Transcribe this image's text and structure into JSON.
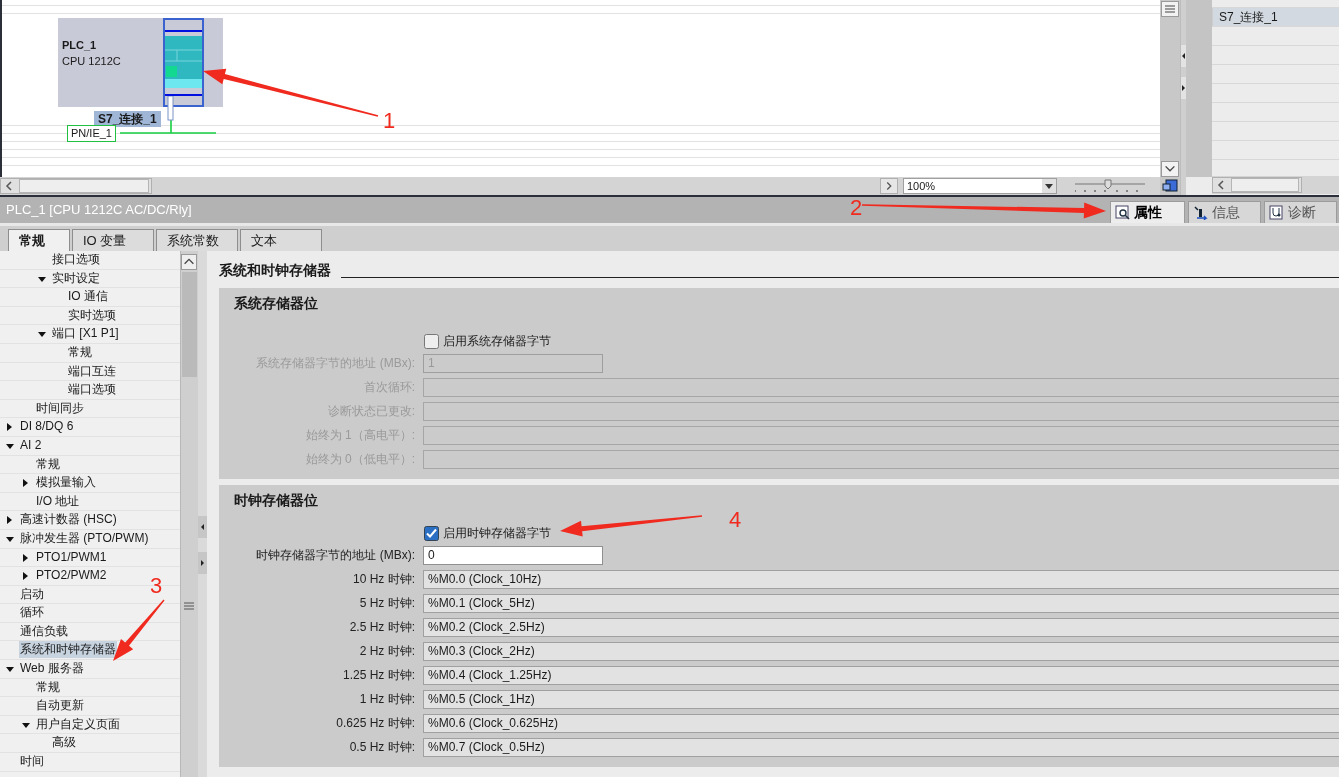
{
  "canvas": {
    "device": {
      "name": "PLC_1",
      "type": "CPU 1212C"
    },
    "connection_label": "S7_连接_1",
    "network_label": "PN/IE_1",
    "zoom": "100%",
    "zoom_slider": {
      "level": 0.47
    }
  },
  "connections_table": {
    "rows": [
      {
        "name": "S7_连接_1",
        "selected": true
      }
    ]
  },
  "inspector": {
    "title": "PLC_1 [CPU 1212C AC/DC/Rly]",
    "view_tabs": [
      {
        "label": "属性",
        "selected": true
      },
      {
        "label": "信息",
        "selected": false
      },
      {
        "label": "诊断",
        "selected": false
      }
    ],
    "tabs": [
      {
        "label": "常规",
        "selected": true
      },
      {
        "label": "IO 变量",
        "selected": false
      },
      {
        "label": "系统常数",
        "selected": false
      },
      {
        "label": "文本",
        "selected": false
      }
    ],
    "tree": [
      {
        "children": [
          {
            "children": [
              {
                "label": "接口选项",
                "selected": false
              },
              {
                "label": "实时设定",
                "selected": false,
                "expanded": true,
                "children": [
                  {
                    "label": "IO 通信",
                    "selected": false
                  },
                  {
                    "label": "实时选项",
                    "selected": false
                  }
                ]
              },
              {
                "label": "端口 [X1 P1]",
                "selected": false,
                "expanded": true,
                "children": [
                  {
                    "label": "常规",
                    "selected": false
                  },
                  {
                    "label": "端口互连",
                    "selected": false
                  },
                  {
                    "label": "端口选项",
                    "selected": false
                  }
                ]
              }
            ]
          },
          {
            "label": "时间同步",
            "selected": false
          }
        ]
      },
      {
        "label": "DI 8/DQ 6",
        "selected": false,
        "expanded": false
      },
      {
        "label": "AI 2",
        "selected": false,
        "expanded": true,
        "children": [
          {
            "label": "常规",
            "selected": false
          },
          {
            "label": "模拟量输入",
            "selected": false,
            "expanded": false
          },
          {
            "label": "I/O 地址",
            "selected": false
          }
        ]
      },
      {
        "label": "高速计数器 (HSC)",
        "selected": false,
        "expanded": false
      },
      {
        "label": "脉冲发生器 (PTO/PWM)",
        "selected": false,
        "expanded": true,
        "children": [
          {
            "label": "PTO1/PWM1",
            "selected": false,
            "expanded": false
          },
          {
            "label": "PTO2/PWM2",
            "selected": false,
            "expanded": false
          }
        ]
      },
      {
        "label": "启动",
        "selected": false
      },
      {
        "label": "循环",
        "selected": false
      },
      {
        "label": "通信负载",
        "selected": false
      },
      {
        "label": "系统和时钟存储器",
        "selected": true
      },
      {
        "label": "Web 服务器",
        "selected": false,
        "expanded": true,
        "children": [
          {
            "label": "常规",
            "selected": false
          },
          {
            "label": "自动更新",
            "selected": false
          },
          {
            "label": "用户自定义页面",
            "selected": false,
            "expanded": true,
            "children": [
              {
                "label": "高级",
                "selected": false
              }
            ]
          }
        ]
      },
      {
        "label": "时间",
        "selected": false
      }
    ],
    "page_title": "系统和时钟存储器",
    "sections": [
      {
        "title": "系统存储器位",
        "checkbox": {
          "label": "启用系统存储器字节",
          "checked": false
        },
        "fields": [
          {
            "label": "系统存储器字节的地址 (MBx):",
            "value": "1",
            "kind": "input"
          },
          {
            "label": "首次循环:",
            "kind": "display"
          },
          {
            "label": "诊断状态已更改:",
            "kind": "display"
          },
          {
            "label": "始终为 1（高电平）:",
            "kind": "display"
          },
          {
            "label": "始终为 0（低电平）:",
            "kind": "display"
          }
        ]
      },
      {
        "title": "时钟存储器位",
        "checkbox": {
          "label": "启用时钟存储器字节",
          "checked": true
        },
        "fields": [
          {
            "label": "时钟存储器字节的地址 (MBx):",
            "value": "0",
            "kind": "input"
          },
          {
            "label": "10 Hz 时钟:",
            "value": "%M0.0 (Clock_10Hz)",
            "kind": "display"
          },
          {
            "label": "5 Hz 时钟:",
            "value": "%M0.1 (Clock_5Hz)",
            "kind": "display"
          },
          {
            "label": "2.5 Hz 时钟:",
            "value": "%M0.2 (Clock_2.5Hz)",
            "kind": "display"
          },
          {
            "label": "2 Hz 时钟:",
            "value": "%M0.3 (Clock_2Hz)",
            "kind": "display"
          },
          {
            "label": "1.25 Hz 时钟:",
            "value": "%M0.4 (Clock_1.25Hz)",
            "kind": "display"
          },
          {
            "label": "1 Hz 时钟:",
            "value": "%M0.5 (Clock_1Hz)",
            "kind": "display"
          },
          {
            "label": "0.625 Hz 时钟:",
            "value": "%M0.6 (Clock_0.625Hz)",
            "kind": "display"
          },
          {
            "label": "0.5 Hz 时钟:",
            "value": "%M0.7 (Clock_0.5Hz)",
            "kind": "display"
          }
        ]
      }
    ]
  },
  "annotations": [
    {
      "label": "1"
    },
    {
      "label": "2"
    },
    {
      "label": "3"
    },
    {
      "label": "4"
    }
  ]
}
